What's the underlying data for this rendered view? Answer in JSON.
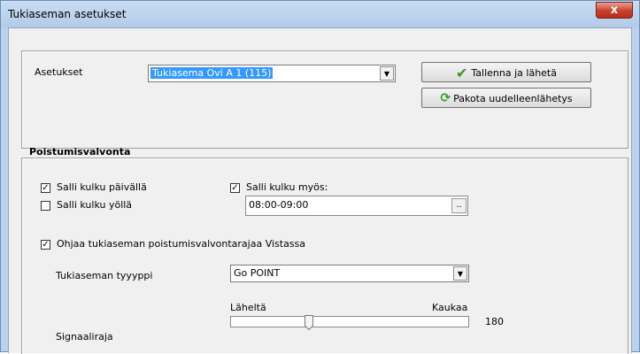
{
  "window": {
    "title": "Tukiaseman asetukset",
    "close_label": "x"
  },
  "top": {
    "settings_label": "Asetukset",
    "settings_select": "Tukiasema Ovi A 1 (115)",
    "save_button": "Tallenna ja lähetä",
    "resend_button": "Pakota uudelleenlähetys"
  },
  "exit": {
    "heading": "Poistumisvalvonta",
    "allow_day": {
      "label": "Salli kulku päivällä",
      "checked": true
    },
    "allow_night": {
      "label": "Salli kulku yöllä",
      "checked": false
    },
    "allow_also": {
      "label": "Salli kulku myös:",
      "checked": true
    },
    "time_range": "08:00-09:00",
    "time_button": "..",
    "control_limit": {
      "label": "Ohjaa tukiaseman poistumisvalvontarajaa Vistassa",
      "checked": true
    },
    "type_label": "Tukiaseman tyyyppi",
    "type_value": "Go POINT",
    "near_label": "Läheltä",
    "far_label": "Kaukaa",
    "signal_label": "Signaaliraja",
    "signal_value": "180",
    "signal_fraction": 0.32
  },
  "icons": {
    "check": "✔",
    "reload": "⟳",
    "dropdown": "▼",
    "checkmark": "✓"
  }
}
